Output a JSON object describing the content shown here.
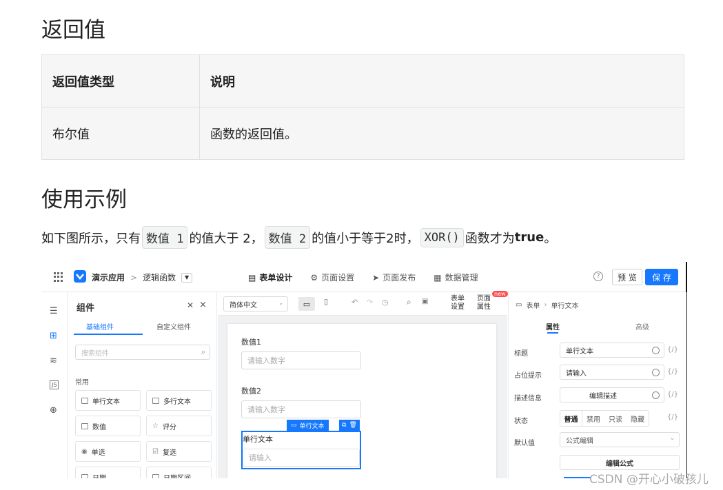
{
  "headings": {
    "return_value": "返回值",
    "example": "使用示例"
  },
  "return_table": {
    "headers": [
      "返回值类型",
      "说明"
    ],
    "rows": [
      [
        "布尔值",
        "函数的返回值。"
      ]
    ]
  },
  "example_paragraph": {
    "prefix": "如下图所示，只有",
    "code1": "数值 1",
    "mid1": "的值大于 2，",
    "code2": "数值 2",
    "mid2": "的值小于等于2时，",
    "code3": "XOR()",
    "mid3": "函数才为",
    "bold": "true",
    "suffix": "。"
  },
  "screenshot": {
    "topbar": {
      "app_name": "演示应用",
      "breadcrumb_sep": ">",
      "page_name": "逻辑函数",
      "tabs": [
        "表单设计",
        "页面设置",
        "页面发布",
        "数据管理"
      ],
      "preview": "预 览",
      "save": "保 存"
    },
    "left_panel": {
      "title": "组件",
      "tabs": [
        "基础组件",
        "自定义组件"
      ],
      "search_placeholder": "搜索组件",
      "section": "常用",
      "components": [
        "单行文本",
        "多行文本",
        "数值",
        "评分",
        "单选",
        "复选",
        "日期",
        "日期区间"
      ]
    },
    "toolbar": {
      "language": "简体中文",
      "form_settings": [
        "表单",
        "设置"
      ],
      "page_props": [
        "页面",
        "属性"
      ],
      "new_badge": "new"
    },
    "canvas": {
      "field1_label": "数值1",
      "field1_placeholder": "请输入数字",
      "field2_label": "数值2",
      "field2_placeholder": "请输入数字",
      "selected_tag": "单行文本",
      "field3_label": "单行文本",
      "field3_placeholder": "请输入"
    },
    "right_panel": {
      "breadcrumb": [
        "表单",
        "单行文本"
      ],
      "tabs": [
        "属性",
        "高级"
      ],
      "rows": [
        {
          "label": "标题",
          "value": "单行文本"
        },
        {
          "label": "占位提示",
          "value": "请输入"
        },
        {
          "label": "描述信息",
          "value": "编辑描述"
        },
        {
          "label": "状态",
          "value": ""
        },
        {
          "label": "默认值",
          "value": "公式编辑"
        }
      ],
      "status_options": [
        "普通",
        "禁用",
        "只读",
        "隐藏"
      ],
      "formula_button": "编辑公式",
      "fx": "{/}"
    }
  },
  "watermark": "CSDN @开心小破孩儿",
  "colors": {
    "accent": "#1677ff"
  }
}
